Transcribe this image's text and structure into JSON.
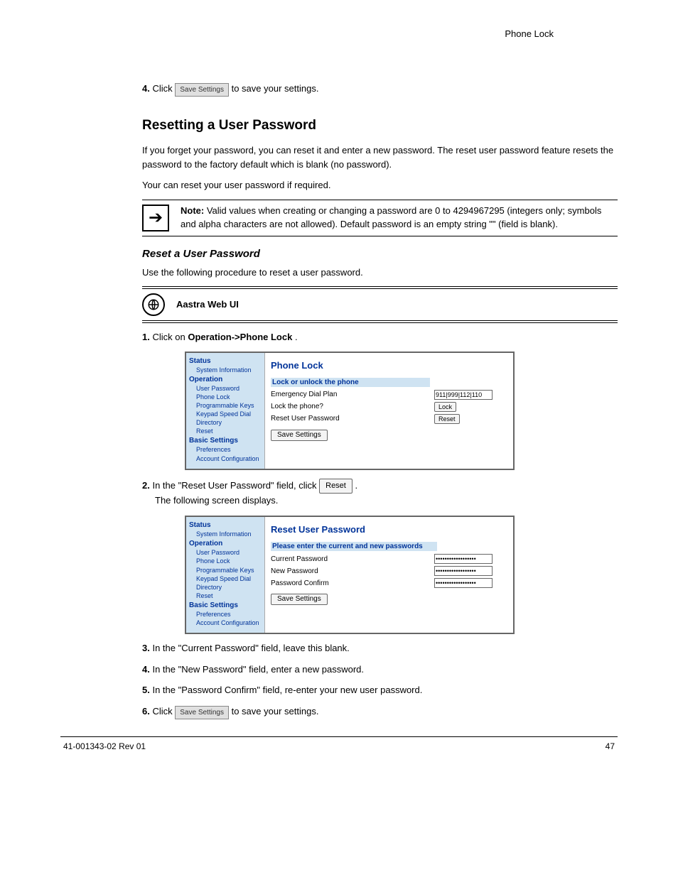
{
  "page_header": "Phone Lock",
  "steps": {
    "a": {
      "prefix": "4.",
      "text_before": "Click ",
      "btn": "Save Settings",
      "text_after": " to save your settings."
    },
    "b": {
      "text": "Your can reset your user password if required."
    },
    "c": {
      "prefix": "2.",
      "text_prefix": "In the \"Reset User Password\" field, click ",
      "reset_btn": "Reset",
      "text_suffix": ".",
      "next_line": "The following screen displays."
    },
    "d3": {
      "prefix": "3.",
      "text": "In the \"Current Password\" field, leave this blank."
    },
    "d4": {
      "prefix": "4.",
      "text": "In the \"New Password\" field, enter a new password."
    },
    "d5": {
      "prefix": "5.",
      "text": "In the \"Password Confirm\" field, re-enter your new user password."
    },
    "d6": {
      "prefix": "6.",
      "text_before": "Click ",
      "btn": "Save Settings",
      "text_after": " to save your settings."
    }
  },
  "section_reset_heading": "Resetting a User Password",
  "reset_intro": "If you forget your password, you can reset it and enter a new password. The reset user password feature resets the password to the factory default which is blank (no password).",
  "note": {
    "label": "Note:",
    "text": "Valid values when creating or changing a password are 0 to 4294967295 (integers only; symbols and alpha characters are not allowed). Default password is an empty string \"\" (field is blank)."
  },
  "webui": {
    "label": "Aastra Web UI"
  },
  "webui_step1": {
    "prefix": "1.",
    "text_before": "Click on ",
    "bold": "Operation->Phone Lock",
    "text_after": "."
  },
  "screenshot1": {
    "title": "Phone Lock",
    "subheader": "Lock or unlock the phone",
    "rows": {
      "emergency": {
        "label": "Emergency Dial Plan",
        "value": "911|999|112|110"
      },
      "lock": {
        "label": "Lock the phone?",
        "btn": "Lock"
      },
      "reset": {
        "label": "Reset User Password",
        "btn": "Reset"
      }
    },
    "save": "Save Settings"
  },
  "screenshot2": {
    "title": "Reset User Password",
    "subheader": "Please enter the current and new passwords",
    "rows": {
      "current": {
        "label": "Current Password",
        "value": "••••••••••••••••••"
      },
      "newp": {
        "label": "New Password",
        "value": "••••••••••••••••••"
      },
      "confirm": {
        "label": "Password Confirm",
        "value": "••••••••••••••••••"
      }
    },
    "save": "Save Settings"
  },
  "sidebar": {
    "status": "Status",
    "sysinfo": "System Information",
    "operation": "Operation",
    "userpw": "User Password",
    "phonelock": "Phone Lock",
    "progkeys": "Programmable Keys",
    "speeddial": "Keypad Speed Dial",
    "directory": "Directory",
    "reset": "Reset",
    "basic": "Basic Settings",
    "prefs": "Preferences",
    "acctcfg": "Account Configuration"
  },
  "footer": {
    "left": "41-001343-02 Rev 01",
    "right": "47"
  }
}
